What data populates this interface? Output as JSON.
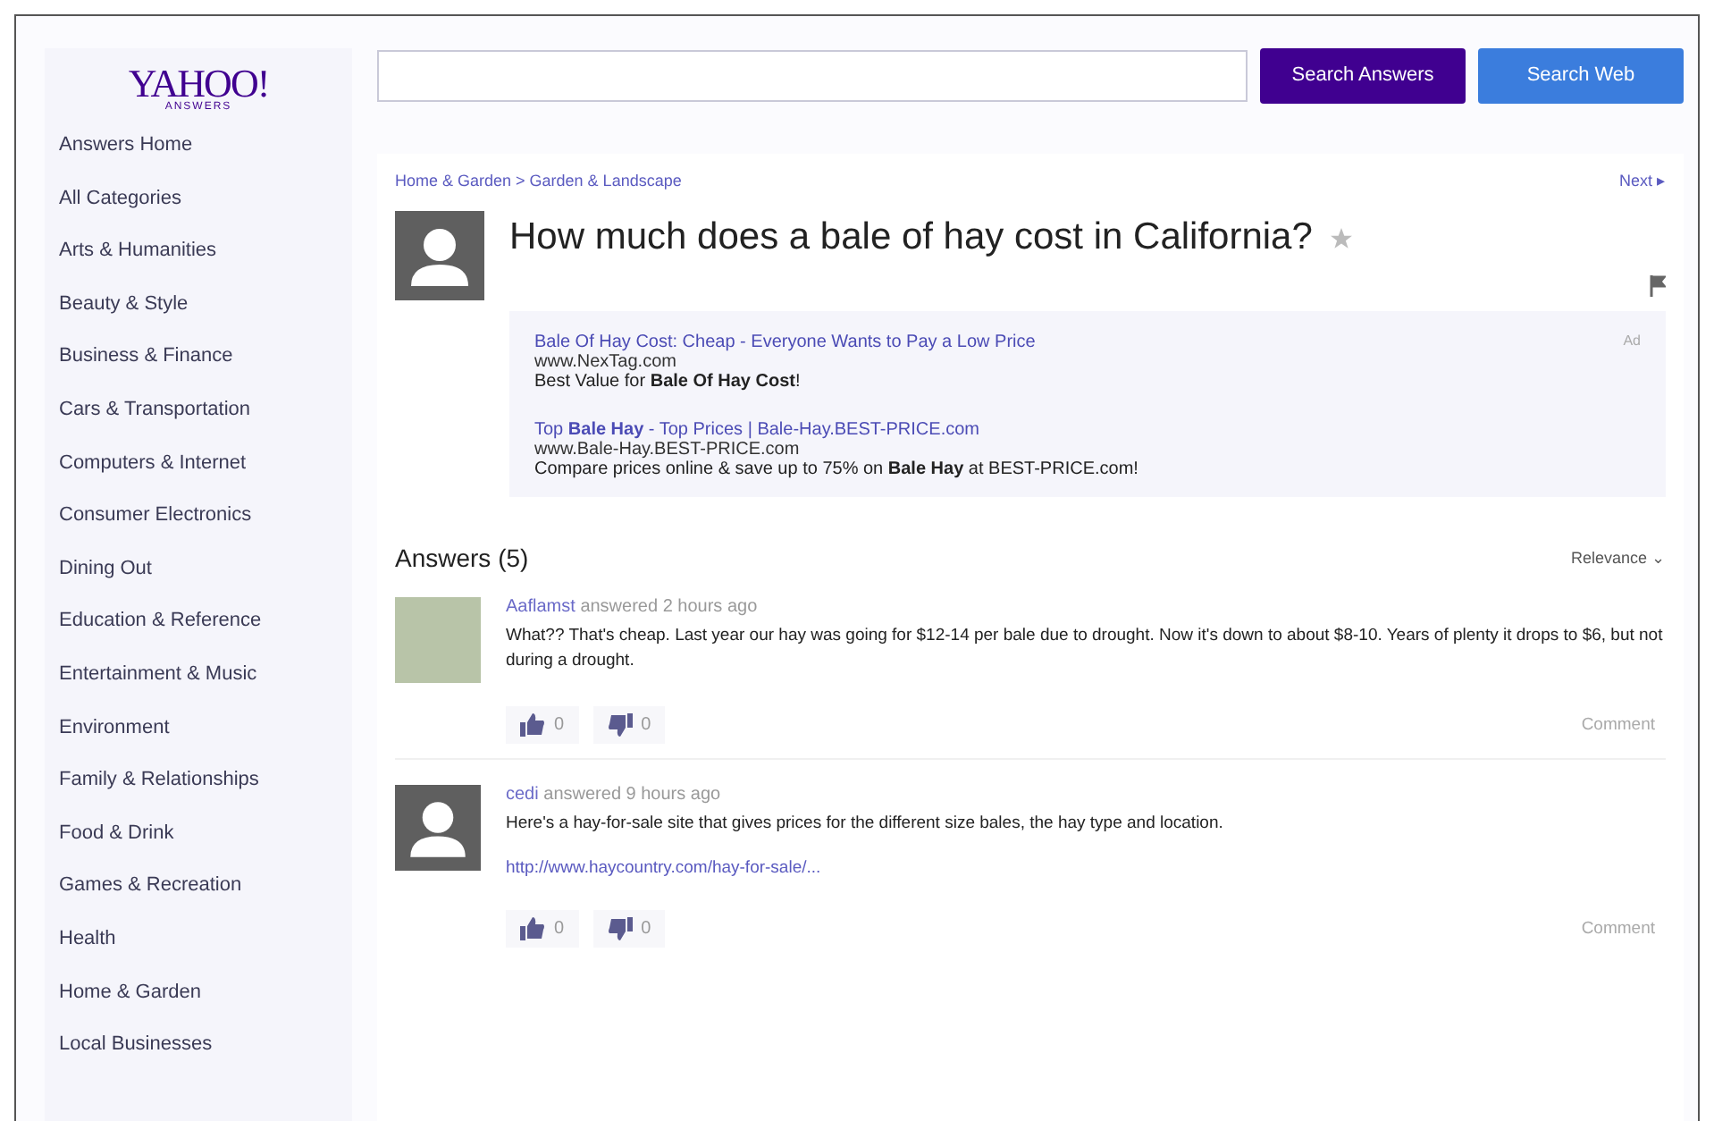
{
  "logo": {
    "brand": "YAHOO!",
    "sub": "ANSWERS"
  },
  "sidebar": {
    "items": [
      {
        "label": "Answers Home"
      },
      {
        "label": "All Categories"
      },
      {
        "label": "Arts & Humanities"
      },
      {
        "label": "Beauty & Style"
      },
      {
        "label": "Business & Finance"
      },
      {
        "label": "Cars & Transportation"
      },
      {
        "label": "Computers & Internet"
      },
      {
        "label": "Consumer Electronics"
      },
      {
        "label": "Dining Out"
      },
      {
        "label": "Education & Reference"
      },
      {
        "label": "Entertainment & Music"
      },
      {
        "label": "Environment"
      },
      {
        "label": "Family & Relationships"
      },
      {
        "label": "Food & Drink"
      },
      {
        "label": "Games & Recreation"
      },
      {
        "label": "Health"
      },
      {
        "label": "Home & Garden"
      },
      {
        "label": "Local Businesses"
      }
    ]
  },
  "search": {
    "buttons": [
      {
        "label": "Search Answers",
        "kind": "primary"
      },
      {
        "label": "Search Web",
        "kind": "secondary"
      }
    ]
  },
  "question": {
    "breadcrumb": "Home & Garden > Garden & Landscape",
    "next": "Next ▸",
    "title": "How much does a bale of hay cost in California?"
  },
  "ads": {
    "label": "Ad",
    "items": [
      {
        "title": "Bale Of Hay Cost: Cheap - Everyone Wants to Pay a Low Price",
        "url": "www.NexTag.com",
        "text": "Best Value for **Bale Of Hay Cost**!"
      },
      {
        "title": "Top **Bale Hay** - Top Prices | Bale-Hay.BEST-PRICE.com",
        "url": "www.Bale-Hay.BEST-PRICE.com",
        "text": "Compare prices online & save up to 75% on **Bale Hay** at BEST-PRICE.com!"
      }
    ]
  },
  "answers": {
    "heading": "Answers (5)",
    "sort": "Relevance ⌄",
    "items": [
      {
        "kind": "photo",
        "author": "Aaflamst",
        "meta": "answered 2 hours ago",
        "text": "What?? That's cheap. Last year our hay was going for $12-14 per bale due to drought. Now it's down to about $8-10. Years of plenty it drops to $6, but not during a drought.",
        "up": "0",
        "down": "0",
        "comment": "Comment"
      },
      {
        "kind": "default",
        "author": "cedi",
        "meta": "answered 9 hours ago",
        "text": "Here's a hay-for-sale site that gives prices for the different size bales, the hay type and location.",
        "link": "http://www.haycountry.com/hay-for-sale/...",
        "up": "0",
        "down": "0",
        "comment": "Comment"
      }
    ]
  }
}
